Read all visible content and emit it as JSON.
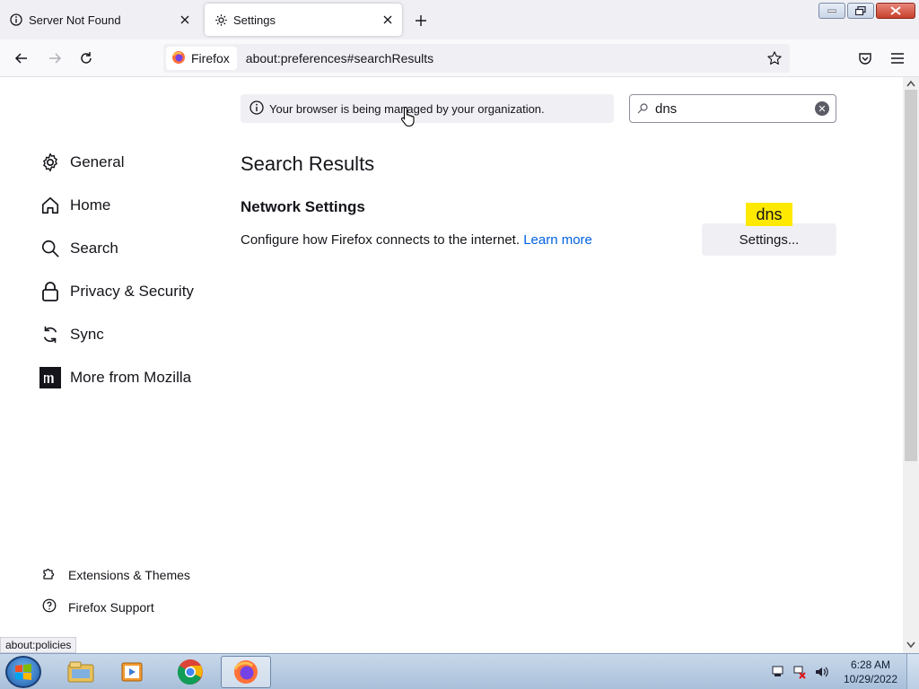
{
  "tabs": [
    {
      "title": "Server Not Found",
      "icon": "info-icon",
      "active": false
    },
    {
      "title": "Settings",
      "icon": "gear-icon",
      "active": true
    }
  ],
  "navbar": {
    "identity_label": "Firefox",
    "url": "about:preferences#searchResults"
  },
  "sidebar": {
    "categories": [
      {
        "label": "General",
        "icon": "gear-icon"
      },
      {
        "label": "Home",
        "icon": "home-icon"
      },
      {
        "label": "Search",
        "icon": "search-icon"
      },
      {
        "label": "Privacy & Security",
        "icon": "lock-icon"
      },
      {
        "label": "Sync",
        "icon": "sync-icon"
      },
      {
        "label": "More from Mozilla",
        "icon": "mozilla-icon"
      }
    ],
    "footer": [
      {
        "label": "Extensions & Themes",
        "icon": "puzzle-icon"
      },
      {
        "label": "Firefox Support",
        "icon": "help-icon"
      }
    ]
  },
  "main": {
    "policy_notice": "Your browser is being managed by your organization.",
    "search_value": "dns",
    "results_title": "Search Results",
    "section_title": "Network Settings",
    "section_desc": "Configure how Firefox connects to the internet.",
    "learn_more": "Learn more",
    "settings_button": "Settings...",
    "search_badge": "dns"
  },
  "status_text": "about:policies",
  "taskbar": {
    "apps": [
      "explorer-icon",
      "media-player-icon",
      "chrome-icon",
      "firefox-icon"
    ],
    "time": "6:28 AM",
    "date": "10/29/2022"
  },
  "colors": {
    "accent_link": "#0061e0",
    "highlight_badge": "#ffe900"
  }
}
